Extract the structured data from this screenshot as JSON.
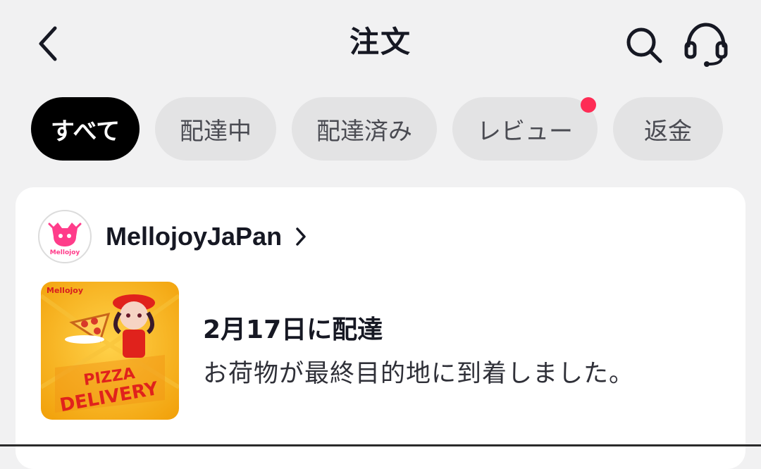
{
  "header": {
    "title": "注文",
    "back_icon": "chevron-left-icon",
    "search_icon": "search-icon",
    "support_icon": "headset-icon"
  },
  "tabs": [
    {
      "label": "すべて",
      "active": true,
      "badge": false
    },
    {
      "label": "配達中",
      "active": false,
      "badge": false
    },
    {
      "label": "配達済み",
      "active": false,
      "badge": false
    },
    {
      "label": "レビュー",
      "active": false,
      "badge": true
    },
    {
      "label": "返金",
      "active": false,
      "badge": false
    }
  ],
  "order": {
    "shop_name": "MellojoyJaPan",
    "shop_logo_text": "Mellojoy",
    "delivery_date": "2月17日に配達",
    "delivery_status": "お荷物が最終目的地に到着しました。",
    "product_image_text": {
      "brand": "Mellojoy",
      "headline1": "PIZZA",
      "headline2": "DELIVERY"
    }
  },
  "colors": {
    "background": "#f1f1f2",
    "active_tab": "#000000",
    "tab": "#e3e3e4",
    "badge": "#fe2c55",
    "card": "#ffffff",
    "brand_pink": "#ff3c8a"
  }
}
